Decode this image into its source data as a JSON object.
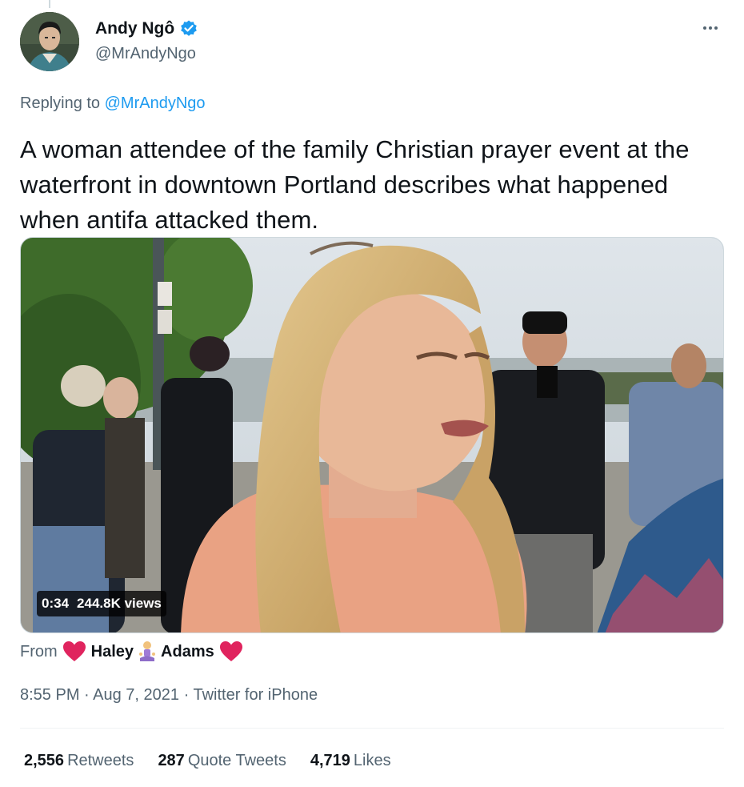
{
  "author": {
    "name": "Andy Ngô",
    "handle": "@MrAndyNgo"
  },
  "icons": {
    "verified": "verified-badge-icon",
    "more": "more-options-icon",
    "heart": "red-heart-emoji",
    "person": "person-in-lotus-position-emoji"
  },
  "reply": {
    "prefix": "Replying to ",
    "handle": "@MrAndyNgo"
  },
  "tweet": {
    "text": "A woman attendee of the family Christian prayer event at the waterfront in downtown Portland describes what happened when antifa attacked them."
  },
  "media": {
    "duration": "0:34",
    "views": "244.8K views"
  },
  "source": {
    "prefix": "From",
    "first": "Haley",
    "last": "Adams"
  },
  "meta": {
    "time": "8:55 PM",
    "sep1": " · ",
    "date": "Aug 7, 2021",
    "sep2": " · ",
    "client": "Twitter for iPhone"
  },
  "stats": {
    "retweets_count": "2,556",
    "retweets_label": "Retweets",
    "quotes_count": "287",
    "quotes_label": "Quote Tweets",
    "likes_count": "4,719",
    "likes_label": "Likes"
  },
  "colors": {
    "link": "#1d9bf0",
    "secondary_text": "#536471",
    "primary_text": "#0f1419",
    "heart": "#e0245e"
  }
}
